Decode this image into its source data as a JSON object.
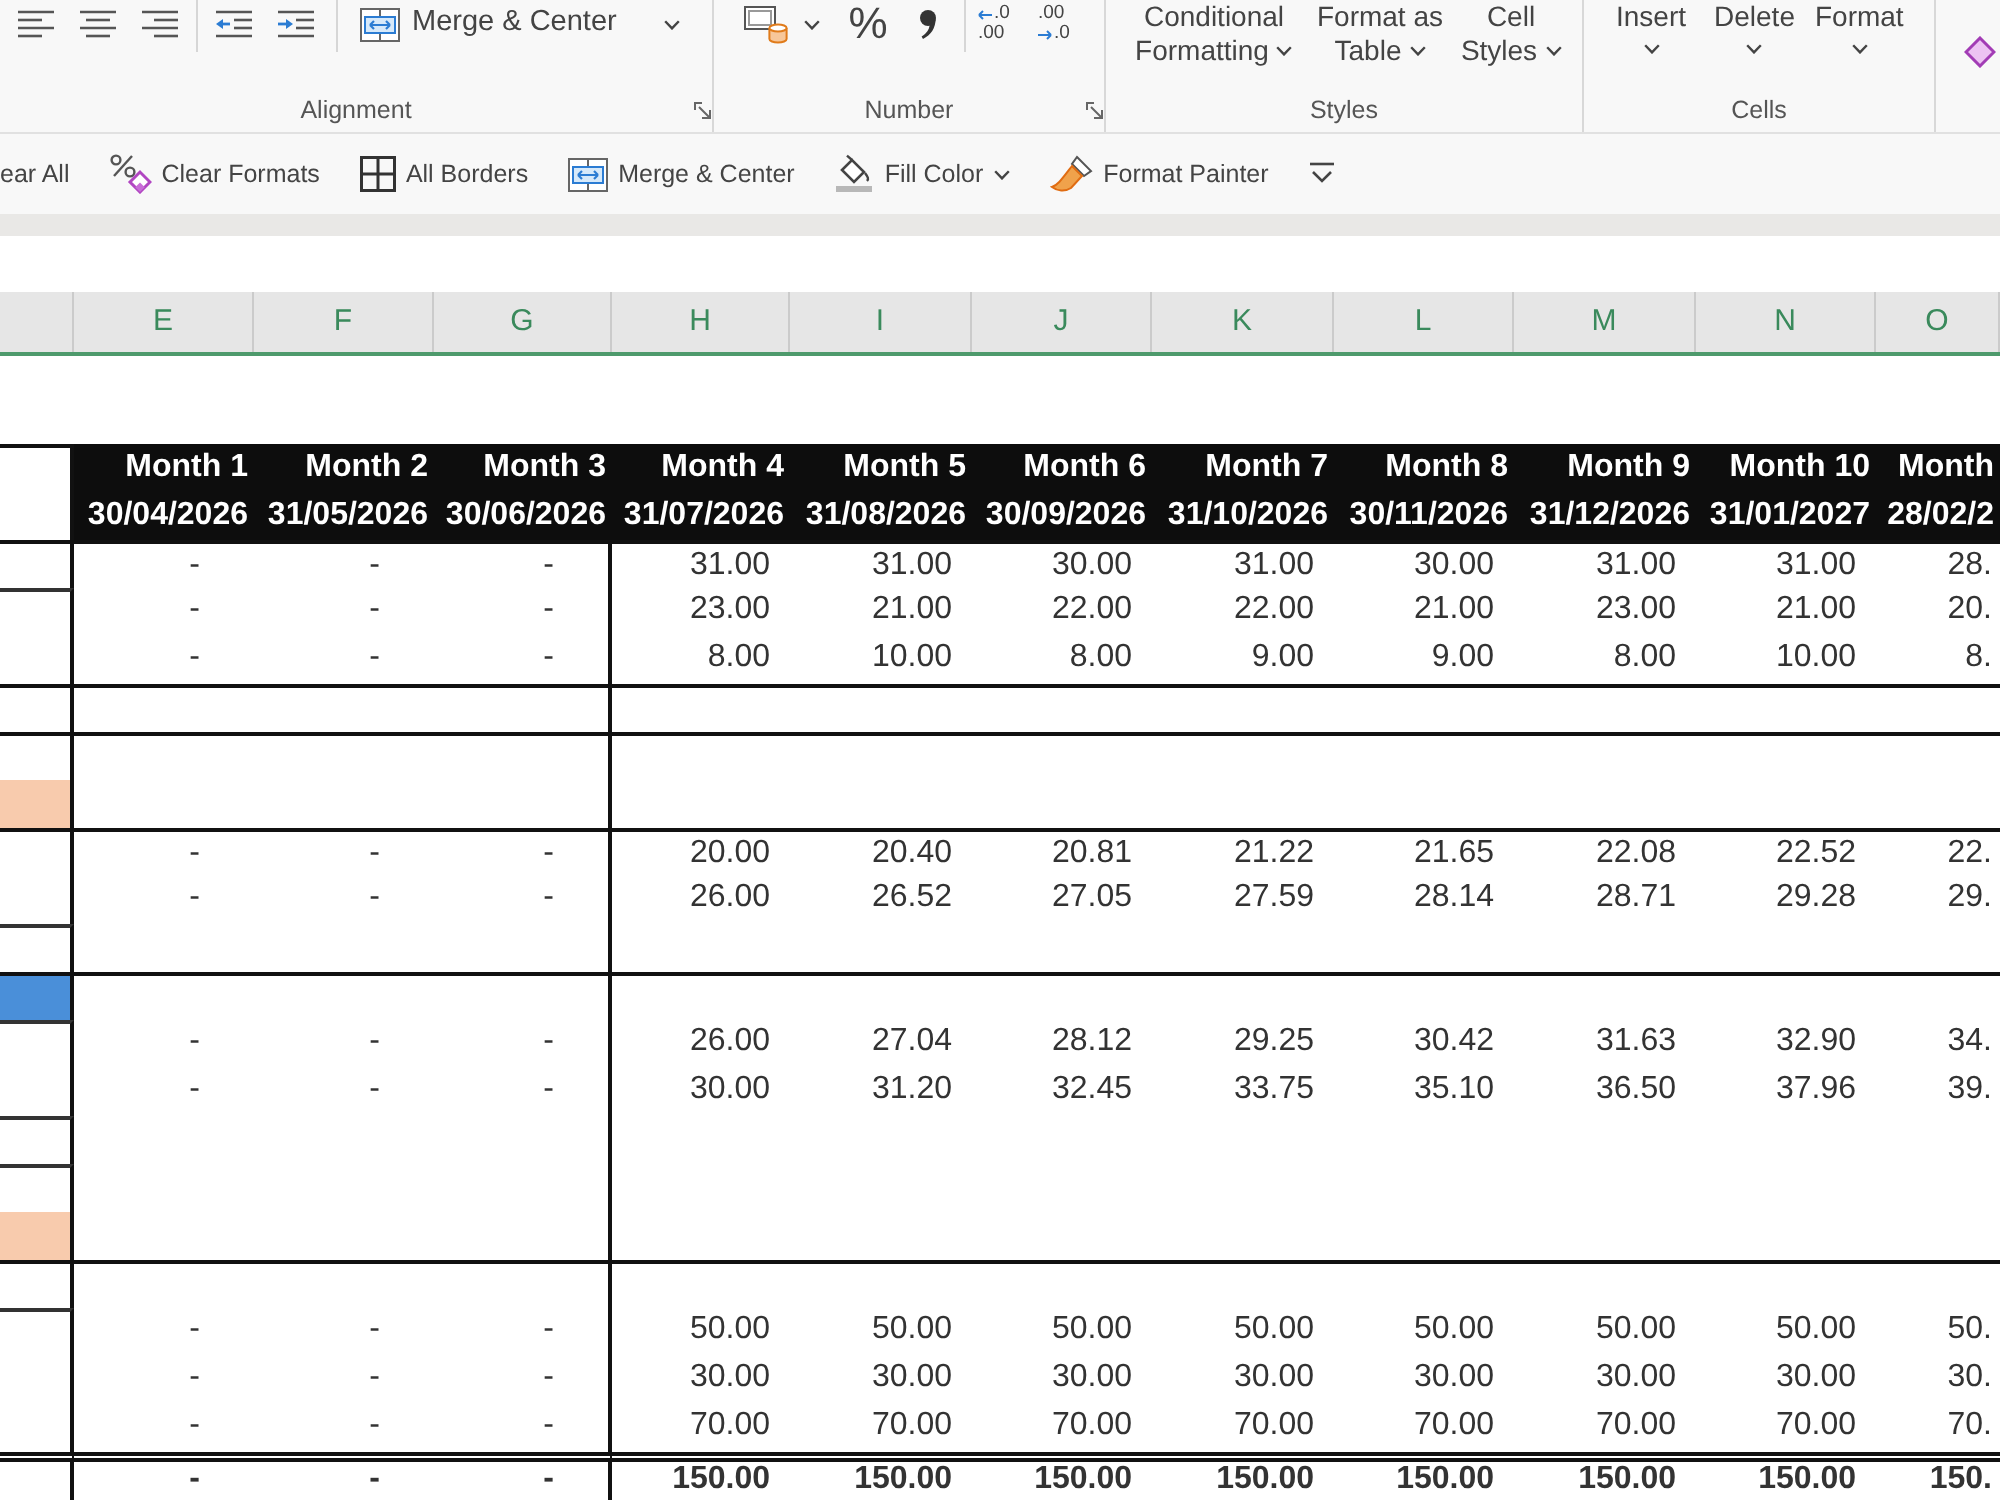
{
  "ribbon": {
    "alignment": {
      "merge_label": "Merge & Center",
      "label": "Alignment"
    },
    "number": {
      "percent": "%",
      "decimal_buttons": [
        {
          "lines": [
            ".0",
            ".00"
          ]
        },
        {
          "lines": [
            ".00",
            ".0"
          ]
        }
      ],
      "label": "Number"
    },
    "styles": {
      "buttons": [
        {
          "lines": [
            "Conditional",
            "Formatting"
          ]
        },
        {
          "lines": [
            "Format as",
            "Table"
          ]
        },
        {
          "lines": [
            "Cell",
            "Styles"
          ]
        }
      ],
      "label": "Styles"
    },
    "cells": {
      "buttons": [
        "Insert",
        "Delete",
        "Format"
      ],
      "label": "Cells"
    }
  },
  "quick_toolbar": [
    {
      "label": "ear All",
      "dropdown": false
    },
    {
      "label": "Clear Formats",
      "dropdown": false
    },
    {
      "label": "All Borders",
      "dropdown": false
    },
    {
      "label": "Merge & Center",
      "dropdown": false
    },
    {
      "label": "Fill Color",
      "dropdown": true
    },
    {
      "label": "Format Painter",
      "dropdown": false
    }
  ],
  "sheet": {
    "column_headers": [
      "E",
      "F",
      "G",
      "H",
      "I",
      "J",
      "K",
      "L",
      "M",
      "N",
      "O"
    ],
    "header": {
      "months": [
        "Month 1",
        "Month 2",
        "Month 3",
        "Month 4",
        "Month 5",
        "Month 6",
        "Month 7",
        "Month 8",
        "Month 9",
        "Month 10",
        "Month"
      ],
      "dates": [
        "30/04/2026",
        "31/05/2026",
        "30/06/2026",
        "31/07/2026",
        "31/08/2026",
        "30/09/2026",
        "31/10/2026",
        "30/11/2026",
        "31/12/2026",
        "31/01/2027",
        "28/02/2"
      ]
    },
    "sections": [
      {
        "kind": "block",
        "groups": [
          {
            "rows": [
              {
                "values": [
                  "-",
                  "-",
                  "-",
                  "31.00",
                  "31.00",
                  "30.00",
                  "31.00",
                  "30.00",
                  "31.00",
                  "31.00",
                  "28."
                ]
              }
            ]
          },
          {
            "rows": [
              {
                "values": [
                  "-",
                  "-",
                  "-",
                  "23.00",
                  "21.00",
                  "22.00",
                  "22.00",
                  "21.00",
                  "23.00",
                  "21.00",
                  "20."
                ]
              },
              {
                "values": [
                  "-",
                  "-",
                  "-",
                  "8.00",
                  "10.00",
                  "8.00",
                  "9.00",
                  "9.00",
                  "8.00",
                  "10.00",
                  "8."
                ]
              }
            ]
          }
        ]
      },
      {
        "kind": "block",
        "groups": [
          {
            "rows": [
              {}
            ]
          }
        ]
      },
      {
        "kind": "block",
        "groups": [
          {
            "rows": [
              {},
              {
                "color": "#f8cbad"
              }
            ]
          }
        ]
      },
      {
        "kind": "block",
        "groups": [
          {
            "rows": [
              {
                "values": [
                  "-",
                  "-",
                  "-",
                  "20.00",
                  "20.40",
                  "20.81",
                  "21.22",
                  "21.65",
                  "22.08",
                  "22.52",
                  "22."
                ]
              },
              {
                "values": [
                  "-",
                  "-",
                  "-",
                  "26.00",
                  "26.52",
                  "27.05",
                  "27.59",
                  "28.14",
                  "28.71",
                  "29.28",
                  "29."
                ]
              }
            ]
          },
          {
            "rows": [
              {}
            ]
          }
        ]
      },
      {
        "kind": "block",
        "groups": [
          {
            "rows": [
              {
                "color": "#4a8fd9"
              }
            ]
          },
          {
            "rows": [
              {
                "values": [
                  "-",
                  "-",
                  "-",
                  "26.00",
                  "27.04",
                  "28.12",
                  "29.25",
                  "30.42",
                  "31.63",
                  "32.90",
                  "34."
                ]
              },
              {
                "values": [
                  "-",
                  "-",
                  "-",
                  "30.00",
                  "31.20",
                  "32.45",
                  "33.75",
                  "35.10",
                  "36.50",
                  "37.96",
                  "39."
                ]
              }
            ]
          },
          {
            "rows": [
              {}
            ]
          },
          {
            "rows": [
              {},
              {
                "color": "#f8cbad"
              }
            ]
          }
        ]
      },
      {
        "kind": "block",
        "groups": [
          {
            "rows": [
              {}
            ]
          },
          {
            "rows": [
              {
                "values": [
                  "-",
                  "-",
                  "-",
                  "50.00",
                  "50.00",
                  "50.00",
                  "50.00",
                  "50.00",
                  "50.00",
                  "50.00",
                  "50."
                ]
              },
              {
                "values": [
                  "-",
                  "-",
                  "-",
                  "30.00",
                  "30.00",
                  "30.00",
                  "30.00",
                  "30.00",
                  "30.00",
                  "30.00",
                  "30."
                ]
              },
              {
                "values": [
                  "-",
                  "-",
                  "-",
                  "70.00",
                  "70.00",
                  "70.00",
                  "70.00",
                  "70.00",
                  "70.00",
                  "70.00",
                  "70."
                ]
              }
            ]
          }
        ]
      },
      {
        "kind": "total",
        "groups": [
          {
            "rows": [
              {
                "values": [
                  "-",
                  "-",
                  "-",
                  "150.00",
                  "150.00",
                  "150.00",
                  "150.00",
                  "150.00",
                  "150.00",
                  "150.00",
                  "150."
                ]
              }
            ]
          }
        ]
      }
    ]
  }
}
